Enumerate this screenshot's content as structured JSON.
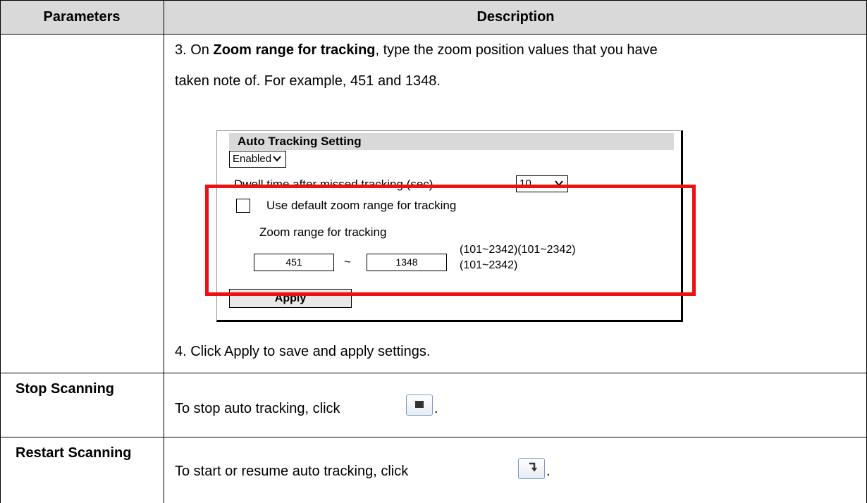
{
  "table": {
    "headers": [
      "Parameters",
      "Description"
    ],
    "rows": [
      {
        "parameter": "",
        "step3_prefix": "3. On ",
        "step3_bold": "Zoom range for tracking",
        "step3_suffix": ", type the zoom position values that you have",
        "step3_line2": "taken note of. For example, 451 and 1348.",
        "step4": "4. Click Apply to save and apply settings."
      },
      {
        "parameter": "Stop Scanning",
        "description": "To stop auto tracking, click",
        "icon": "stop-icon",
        "trail": "."
      },
      {
        "parameter": "Restart Scanning",
        "description": "To start or resume auto tracking, click",
        "icon": "resume-arrow-icon",
        "trail": "."
      }
    ]
  },
  "screenshot": {
    "title": "Auto Tracking Setting",
    "enable_select": "Enabled",
    "dwell_label": "Dwell time after missed tracking (sec)",
    "dwell_select": "10",
    "default_zoom_label": "Use default zoom range for tracking",
    "default_zoom_checked": false,
    "zoom_range_label": "Zoom range for tracking",
    "zoom_min": "451",
    "tilde": "~",
    "zoom_max": "1348",
    "range_hint_line1": "(101~2342)(101~2342)",
    "range_hint_line2": "(101~2342)",
    "apply_label": "Apply"
  },
  "colors": {
    "header_bg": "#d9d9d9",
    "highlight": "#ee1111"
  }
}
